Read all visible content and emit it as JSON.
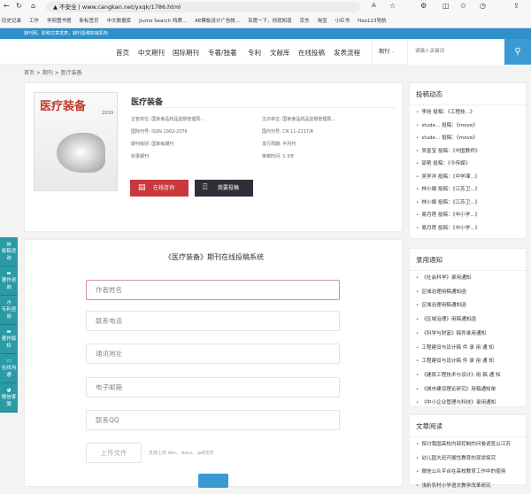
{
  "browser": {
    "security": "不安全",
    "url": "www.cangkan.net/yxqk/1786.html",
    "bookmarks": [
      "历史记录",
      "工作",
      "学府图书馆",
      "新标签页",
      "中文数据库",
      "Jiumo Search 鸠摩...",
      "AE模板设计广告帐...",
      "百度一下，你就知道",
      "京东",
      "淘宝",
      "小红书",
      "Hao123导航"
    ]
  },
  "banner": "期刊网，职称文章发表，期刊投稿权威机构",
  "nav": {
    "items": [
      "首页",
      "中文期刊",
      "国际期刊",
      "专著/独著",
      "专利",
      "文献库",
      "在线投稿",
      "发表流程"
    ],
    "search_select": "期刊",
    "search_placeholder": "请输入关键词"
  },
  "breadcrumb": "首页 > 期刊 > 医疗装备",
  "journal": {
    "cover_title": "医疗装备",
    "cover_year": "2019",
    "title": "医疗装备",
    "info": [
      [
        "主管单位:",
        "国家食品药品监督管理局..."
      ],
      [
        "主办单位:",
        "国家食品药品监督管理局..."
      ],
      [
        "国际刊号:",
        "ISSN 1002-2376"
      ],
      [
        "国内刊号:",
        "CN 11-2217/R"
      ],
      [
        "期刊级别:",
        "国家级期刊"
      ],
      [
        "发行周期:",
        "半月刊"
      ],
      [
        "收录期刊:",
        ""
      ],
      [
        "审稿时间:",
        "1-3天"
      ]
    ],
    "consult_btn": "在线咨询",
    "submit_btn": "我要投稿"
  },
  "float_sidebar": [
    "投稿咨询",
    "著作咨询",
    "专利咨询",
    "著作版权",
    "在线沟通",
    "微信客服"
  ],
  "form": {
    "title": "《医疗装备》期刊在线投稿系统",
    "fields": [
      "作者姓名",
      "联系电话",
      "通讯地址",
      "电子邮箱",
      "联系QQ"
    ],
    "upload": "上传文件",
    "upload_hint": "支持上传.doc、.docx、.pdf文件"
  },
  "sidebar": {
    "dynamics": {
      "title": "投稿动态",
      "items": [
        "李旭 投稿：《工程技...》",
        "stude... 投稿：《move》",
        "stude... 投稿：《move》",
        "吴富宝 投稿：《中国教师》",
        "邵艳 投稿：《今传媒》",
        "吴学洋 投稿：《中学课...》",
        "林小娟 投稿：《江苏卫...》",
        "林小娟 投稿：《江苏卫...》",
        "易月莲 投稿：《中小学...》",
        "易月莲 投稿：《中小学...》"
      ]
    },
    "notices": {
      "title": "录用通知",
      "items": [
        "《社会科学》录用通知",
        "区域治理用稿通知函",
        "区域治理用稿通知函",
        "《区域治理》用稿通知函",
        "《科学与财富》稿件录用通知",
        "工程建设与设计稿 件 录 用 通 知",
        "工程建设与设计稿 件 录 用 通 知",
        "《建筑工程技术与设计》用 稿 通 知",
        "《城市建设理论研究》用稿通知单",
        "《中小企业管理与科技》录用通知"
      ]
    },
    "articles": {
      "title": "文章阅读",
      "items": [
        "探讨我国高校内部控制的问卷调查以江苏",
        "幼儿园大班开展性教育的现状探究",
        "微信公众平台在高校教育工作中的使用",
        "浅析农村小学语文教学改革研究"
      ]
    }
  }
}
